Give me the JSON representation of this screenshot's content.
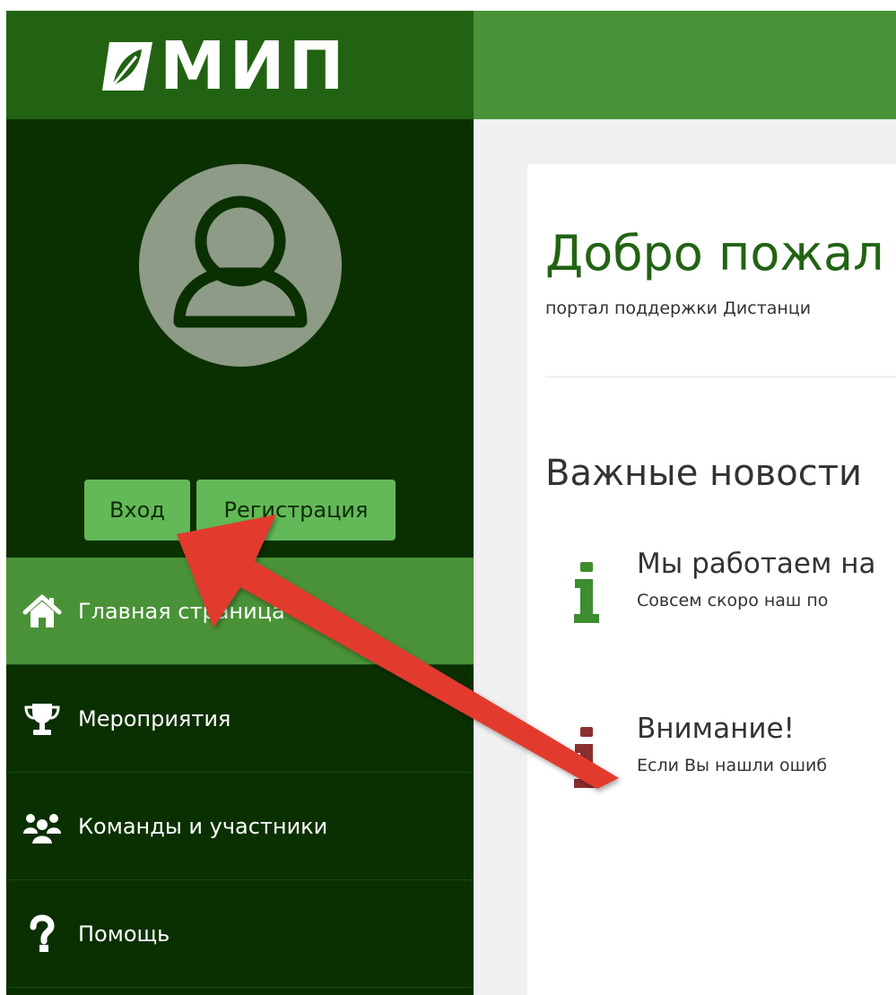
{
  "brand": {
    "logo_text": "МИП",
    "colors": {
      "logo_bar": "#226313",
      "header_bar": "#4a9237",
      "sidebar": "#0a3001",
      "button": "#63b957",
      "active_item": "#4a9237",
      "heading_green": "#226313",
      "news_icon_green": "#3d8d2f",
      "news_icon_red": "#8b2f2f",
      "annotation_arrow": "#e23a2f"
    }
  },
  "auth": {
    "login_label": "Вход",
    "register_label": "Регистрация"
  },
  "menu": [
    {
      "icon": "home-icon",
      "label": "Главная страница",
      "active": true
    },
    {
      "icon": "trophy-icon",
      "label": "Мероприятия",
      "active": false
    },
    {
      "icon": "users-icon",
      "label": "Команды и участники",
      "active": false
    },
    {
      "icon": "question-icon",
      "label": "Помощь",
      "active": false
    }
  ],
  "main": {
    "title": "Добро пожал",
    "subtitle": "портал поддержки Дистанци",
    "news_heading": "Важные новости",
    "news": [
      {
        "icon": "info-icon",
        "color": "#3d8d2f",
        "title": "Мы работаем на",
        "text": "Совсем скоро наш по"
      },
      {
        "icon": "info-icon",
        "color": "#8b2f2f",
        "title": "Внимание!",
        "text": "Если Вы нашли ошиб"
      }
    ]
  }
}
